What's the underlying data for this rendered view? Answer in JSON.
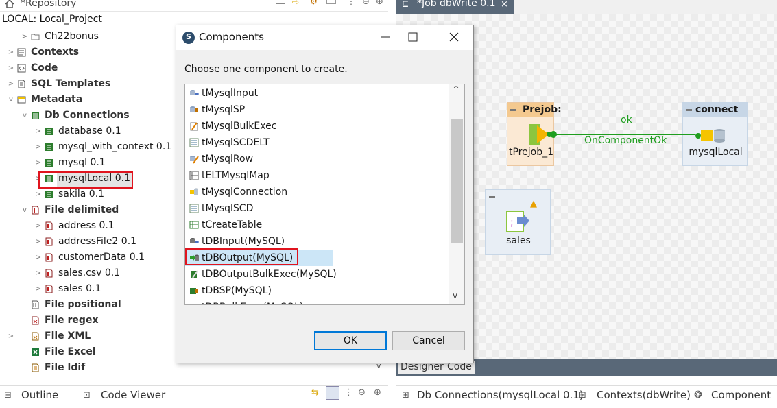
{
  "repository": {
    "tab_title": "*Repository",
    "path": "LOCAL: Local_Project",
    "items": [
      {
        "label": "Ch22bonus",
        "type": "folder"
      },
      {
        "label": "Contexts",
        "type": "section"
      },
      {
        "label": "Code",
        "type": "section"
      },
      {
        "label": "SQL Templates",
        "type": "section"
      },
      {
        "label": "Metadata",
        "type": "section"
      },
      {
        "label": "Db Connections",
        "type": "section"
      },
      {
        "label": "database 0.1",
        "type": "db"
      },
      {
        "label": "mysql_with_context 0.1",
        "type": "db"
      },
      {
        "label": "mysql 0.1",
        "type": "db"
      },
      {
        "label": "mysqlLocal 0.1",
        "type": "db",
        "highlighted": true
      },
      {
        "label": "sakila 0.1",
        "type": "db"
      },
      {
        "label": "File delimited",
        "type": "section"
      },
      {
        "label": "address 0.1",
        "type": "file"
      },
      {
        "label": "addressFile2 0.1",
        "type": "file"
      },
      {
        "label": "customerData 0.1",
        "type": "file"
      },
      {
        "label": "sales.csv 0.1",
        "type": "file"
      },
      {
        "label": "sales 0.1",
        "type": "file"
      },
      {
        "label": "File positional",
        "type": "section"
      },
      {
        "label": "File regex",
        "type": "section"
      },
      {
        "label": "File XML",
        "type": "section"
      },
      {
        "label": "File Excel",
        "type": "section"
      },
      {
        "label": "File ldif",
        "type": "section"
      }
    ]
  },
  "job": {
    "tab_title": "*Job dbWrite 0.1",
    "designer_tab": "Designer",
    "code_tab": "Code",
    "prejob": {
      "header": "Prejob:",
      "label": "tPrejob_1"
    },
    "connect": {
      "header": "connect",
      "label": "mysqlLocal"
    },
    "link_ok": "ok",
    "link_trigger": "OnComponentOk",
    "sales": {
      "label": "sales"
    }
  },
  "dialog": {
    "title": "Components",
    "prompt": "Choose one component to create.",
    "items": [
      "tMysqlInput",
      "tMysqlSP",
      "tMysqlBulkExec",
      "tMysqlSCDELT",
      "tMysqlRow",
      "tELTMysqlMap",
      "tMysqlConnection",
      "tMysqlSCD",
      "tCreateTable",
      "tDBInput(MySQL)",
      "tDBOutput(MySQL)",
      "tDBOutputBulkExec(MySQL)",
      "tDBSP(MySQL)",
      "tDBBulkExec(MySQL)"
    ],
    "selected_item": "tDBOutput(MySQL)",
    "ok": "OK",
    "cancel": "Cancel"
  },
  "bottom_left": {
    "outline": "Outline",
    "code_viewer": "Code Viewer"
  },
  "bottom_right": {
    "db_connections": "Db Connections(mysqlLocal 0.1)",
    "contexts": "Contexts(dbWrite)",
    "component": "Component"
  },
  "colors": {
    "highlight_red": "#e0141e",
    "editor_tab": "#596878",
    "link_green": "#1f9e1f",
    "selection": "#cce6f7"
  }
}
